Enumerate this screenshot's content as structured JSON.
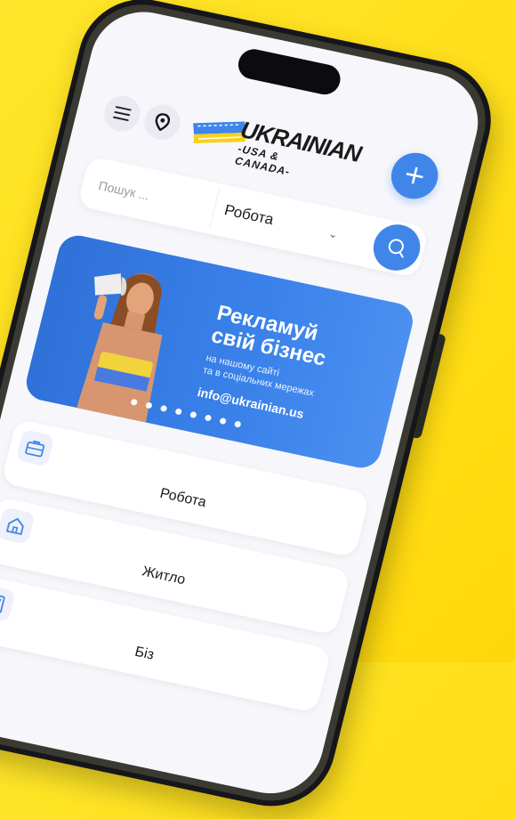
{
  "header": {
    "logo_word": "UKRAINIAN",
    "logo_sub": "-USA & CANADA-",
    "add_label": "+"
  },
  "search": {
    "placeholder": "Пошук ...",
    "category": "Робота"
  },
  "banner": {
    "title_line1": "Рекламуй",
    "title_line2": "свій бізнес",
    "sub_line1": "на нашому сайті",
    "sub_line2": "та в соціальних мережах",
    "email": "info@ukrainian.us",
    "slide_count": 8,
    "active_slide": 3
  },
  "categories": [
    {
      "label": "Робота",
      "icon": "briefcase-icon"
    },
    {
      "label": "Житло",
      "icon": "home-icon"
    },
    {
      "label": "Біз",
      "icon": "building-icon"
    }
  ],
  "colors": {
    "accent": "#3f86e8",
    "background": "#ffe62a"
  }
}
